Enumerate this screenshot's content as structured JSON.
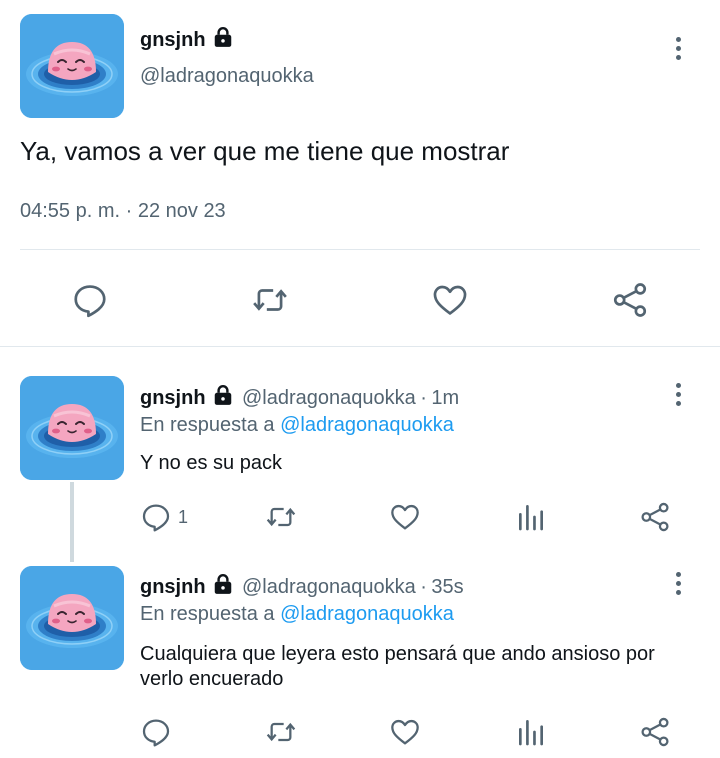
{
  "main_tweet": {
    "display_name": "gnsjnh",
    "handle": "@ladragonaquokka",
    "text": "Ya, vamos a ver que me tiene que mostrar",
    "timestamp": "04:55 p. m. · 22 nov 23",
    "actions": [
      "reply-icon",
      "retweet-icon",
      "like-icon",
      "share-icon"
    ]
  },
  "replies": [
    {
      "display_name": "gnsjnh",
      "handle": "@ladragonaquokka",
      "time": "1m",
      "separator": "·",
      "in_reply_prefix": "En respuesta a",
      "in_reply_to": "@ladragonaquokka",
      "text": "Y no es su pack",
      "reply_count": "1"
    },
    {
      "display_name": "gnsjnh",
      "handle": "@ladragonaquokka",
      "time": "35s",
      "separator": "·",
      "in_reply_prefix": "En respuesta a",
      "in_reply_to": "@ladragonaquokka",
      "text": "Cualquiera que leyera esto pensará que ando ansioso por verlo encuerado",
      "reply_count": ""
    }
  ],
  "colors": {
    "accent": "#1d9bf0",
    "secondary_text": "#536471",
    "divider": "#e1e8ed"
  }
}
